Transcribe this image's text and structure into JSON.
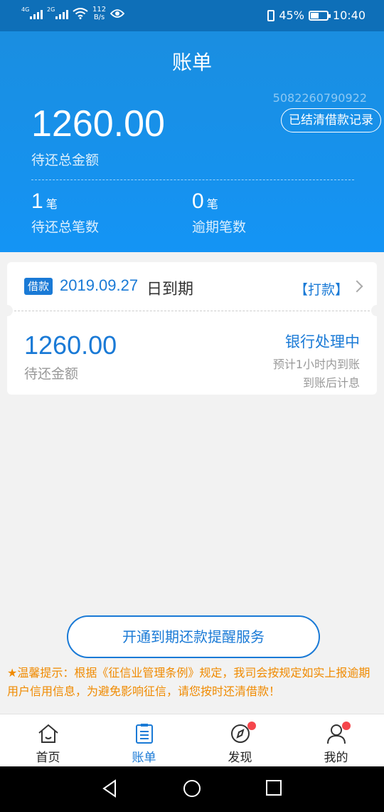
{
  "status_bar": {
    "net1": "4G",
    "net2": "2G",
    "speed_value": "112",
    "speed_unit": "B/s",
    "battery": "45%",
    "battery_level": 0.45,
    "time": "10:40"
  },
  "header": {
    "title": "账单",
    "account_no": "5082260790922",
    "settled_button": "已结清借款记录",
    "total_amount": "1260.00",
    "total_label": "待还总金额",
    "pending_count": "1",
    "pending_unit": "笔",
    "pending_label": "待还总笔数",
    "overdue_count": "0",
    "overdue_unit": "笔",
    "overdue_label": "逾期笔数"
  },
  "loan_card": {
    "tag": "借款",
    "due_date": "2019.09.27",
    "due_suffix": "日到期",
    "pay_link": "【打款】",
    "amount": "1260.00",
    "amount_label": "待还金额",
    "status": "银行处理中",
    "eta": "预计1小时内到账",
    "interest_note": "到账后计息"
  },
  "reminder": {
    "button": "开通到期还款提醒服务",
    "tip": "★温馨提示：根据《征信业管理条例》规定，我司会按规定如实上报逾期用户信用信息，为避免影响征信，请您按时还清借款！"
  },
  "tabs": [
    {
      "label": "首页",
      "icon": "home-icon"
    },
    {
      "label": "账单",
      "icon": "bill-icon"
    },
    {
      "label": "发现",
      "icon": "compass-icon"
    },
    {
      "label": "我的",
      "icon": "user-icon"
    }
  ],
  "colors": {
    "primary": "#1a7ad6",
    "header": "#1494f5",
    "warning": "#f08a00",
    "badge": "#f5464c"
  }
}
